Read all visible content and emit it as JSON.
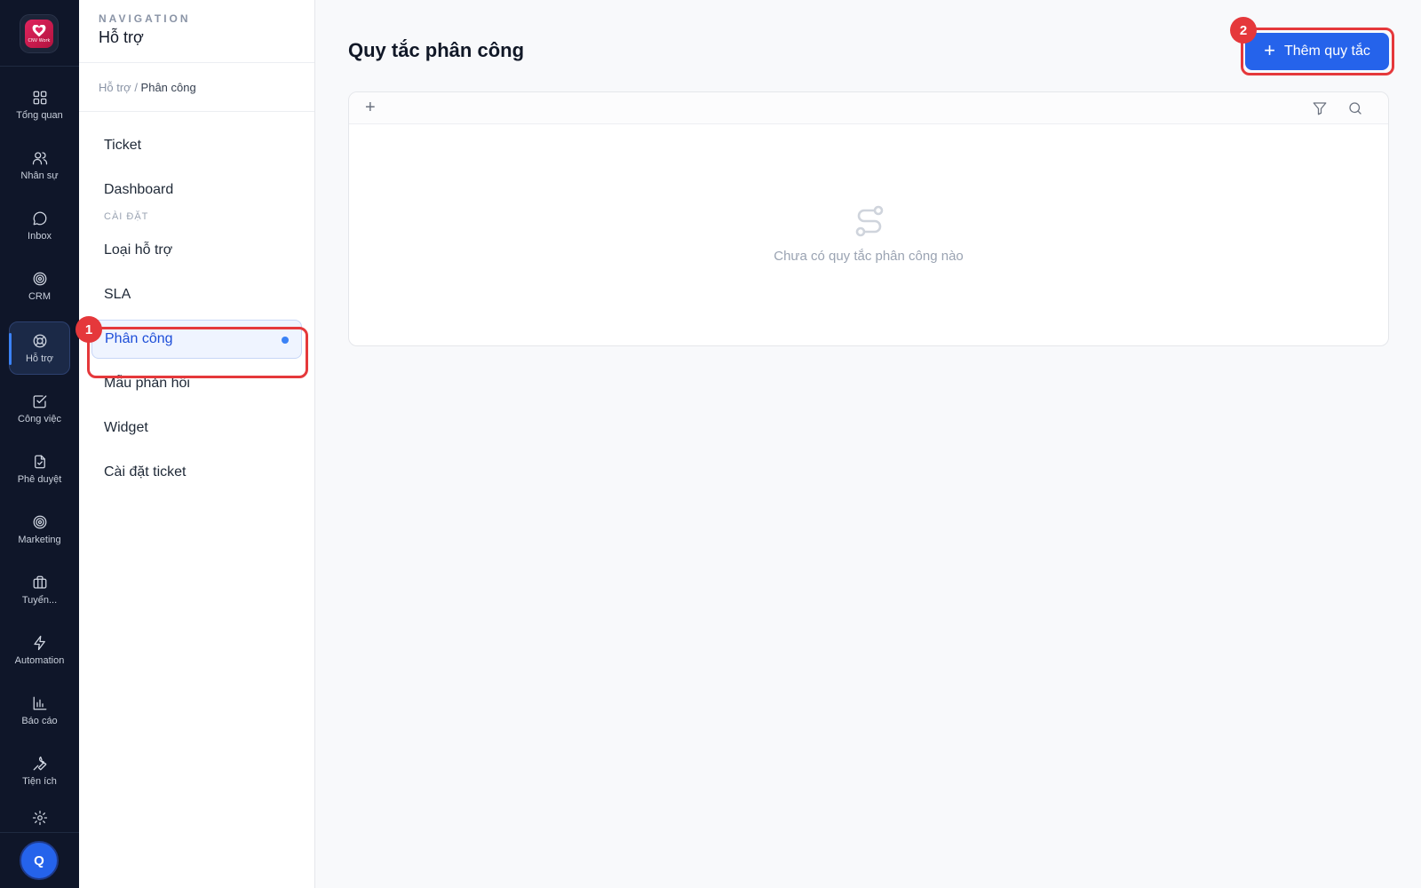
{
  "app": {
    "logo_text": "CNV Work"
  },
  "rail": {
    "items": [
      {
        "label": "Tổng quan",
        "icon": "dashboard-grid-icon"
      },
      {
        "label": "Nhân sự",
        "icon": "users-icon"
      },
      {
        "label": "Inbox",
        "icon": "chat-bubble-icon"
      },
      {
        "label": "CRM",
        "icon": "target-icon"
      },
      {
        "label": "Hỗ trợ",
        "icon": "lifebuoy-icon",
        "active": true
      },
      {
        "label": "Công việc",
        "icon": "checkbox-icon"
      },
      {
        "label": "Phê duyệt",
        "icon": "document-approve-icon"
      },
      {
        "label": "Marketing",
        "icon": "target-icon"
      },
      {
        "label": "Tuyển...",
        "icon": "briefcase-icon"
      },
      {
        "label": "Automation",
        "icon": "lightning-icon"
      },
      {
        "label": "Báo cáo",
        "icon": "bar-chart-icon"
      },
      {
        "label": "Tiện ích",
        "icon": "wrench-icon"
      }
    ],
    "settings_icon": "gear-icon",
    "avatar_initial": "Q"
  },
  "nav": {
    "kicker": "NAVIGATION",
    "title": "Hỗ trợ",
    "breadcrumb": {
      "parent": "Hỗ trợ",
      "separator": " / ",
      "current": "Phân công"
    },
    "items_top": [
      "Ticket",
      "Dashboard"
    ],
    "section_label": "CÀI ĐẶT",
    "items_settings": [
      "Loại hỗ trợ",
      "SLA",
      "Phân công",
      "Mẫu phản hồi",
      "Widget",
      "Cài đặt ticket"
    ],
    "active_item": "Phân công"
  },
  "main": {
    "title": "Quy tắc phân công",
    "add_button_label": "Thêm quy tắc",
    "empty_message": "Chưa có quy tắc phân công nào"
  },
  "annotations": {
    "badge_1": "1",
    "badge_2": "2"
  },
  "colors": {
    "accent": "#2563eb",
    "highlight": "#e5383b",
    "rail_bg": "#0f1629"
  }
}
